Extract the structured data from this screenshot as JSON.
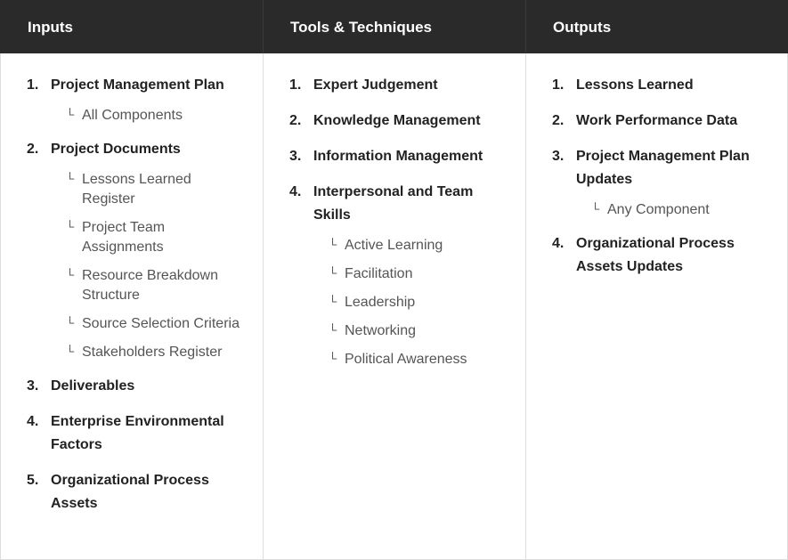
{
  "columns": [
    {
      "title": "Inputs",
      "items": [
        {
          "num": "1.",
          "label": "Project Management Plan",
          "subs": [
            "All Components"
          ]
        },
        {
          "num": "2.",
          "label": "Project Documents",
          "subs": [
            "Lessons Learned Register",
            "Project Team Assignments",
            "Resource Breakdown Structure",
            "Source Selection Criteria",
            "Stakeholders Register"
          ]
        },
        {
          "num": "3.",
          "label": "Deliverables",
          "subs": []
        },
        {
          "num": "4.",
          "label": "Enterprise Environmental Factors",
          "subs": []
        },
        {
          "num": "5.",
          "label": "Organizational Process Assets",
          "subs": []
        }
      ]
    },
    {
      "title": "Tools & Techniques",
      "items": [
        {
          "num": "1.",
          "label": "Expert Judgement",
          "subs": []
        },
        {
          "num": "2.",
          "label": "Knowledge Management",
          "subs": []
        },
        {
          "num": "3.",
          "label": "Information Management",
          "subs": []
        },
        {
          "num": "4.",
          "label": "Interpersonal and Team Skills",
          "subs": [
            "Active Learning",
            "Facilitation",
            "Leadership",
            "Networking",
            "Political Awareness"
          ]
        }
      ]
    },
    {
      "title": "Outputs",
      "items": [
        {
          "num": "1.",
          "label": "Lessons Learned",
          "subs": []
        },
        {
          "num": "2.",
          "label": "Work Performance Data",
          "subs": []
        },
        {
          "num": "3.",
          "label": "Project Management Plan Updates",
          "subs": [
            "Any Component"
          ]
        },
        {
          "num": "4.",
          "label": "Organizational Process Assets Updates",
          "subs": []
        }
      ]
    }
  ],
  "sub_glyph": "└",
  "colors": {
    "header_bg": "#2a2a2a",
    "header_text": "#ffffff",
    "item_text": "#222222",
    "sub_text": "#555555",
    "border": "#dddddd"
  }
}
